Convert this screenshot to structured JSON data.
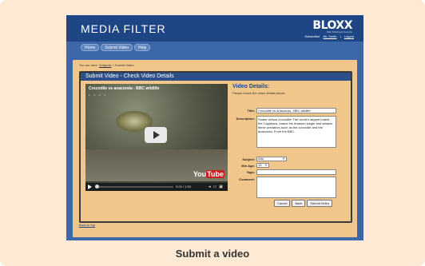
{
  "header": {
    "app_title": "MEDIA FILTER",
    "logo": "BLOXX",
    "logo_sub": "Web Filtering & Security",
    "subscriber_label": "Subscriber",
    "user_name": "Mr. Smith",
    "logout_label": "Logout"
  },
  "nav": [
    "Home",
    "Submit Video",
    "Help"
  ],
  "breadcrumb": {
    "prefix": "You are here:",
    "link": "Subjects",
    "current": "> Submit Video"
  },
  "panel": {
    "title": "Submit Video - Check Video Details"
  },
  "video": {
    "title": "Crocodile vs anaconda - BBC wildlife",
    "rating_dots": "• • • •",
    "time": "0:00 / 1:53",
    "brand_you": "You",
    "brand_tube": "Tube"
  },
  "details": {
    "heading": "Video Details:",
    "note": "Please check the video details below.",
    "title_label": "Title:",
    "title_value": "Crocodile vs anaconda - BBC wildlife",
    "description_label": "Description:",
    "description_value": "Snake versus crocodile! The world's largest rodent, the Capybara, roams the Amazon jungle and attracts fierce predators such as the crocodile and the anaconda.  From the BBC.",
    "subject_label": "Subject:",
    "subject_value": "Arts",
    "min_age_label": "Min Age:",
    "min_age_value": "15",
    "tags_label": "Tags:",
    "tags_value": "",
    "comment_label": "Comment:",
    "comment_value": ""
  },
  "buttons": {
    "cancel": "Cancel",
    "back": "Back",
    "submit": "Submit Video"
  },
  "footer": {
    "back_to_top": "Back to top"
  },
  "caption": "Submit a video",
  "colors": {
    "header_blue": "#1f4684",
    "page_blue": "#3c67a8",
    "content_tan": "#f1c68a",
    "frame_peach": "#fde9d4"
  }
}
